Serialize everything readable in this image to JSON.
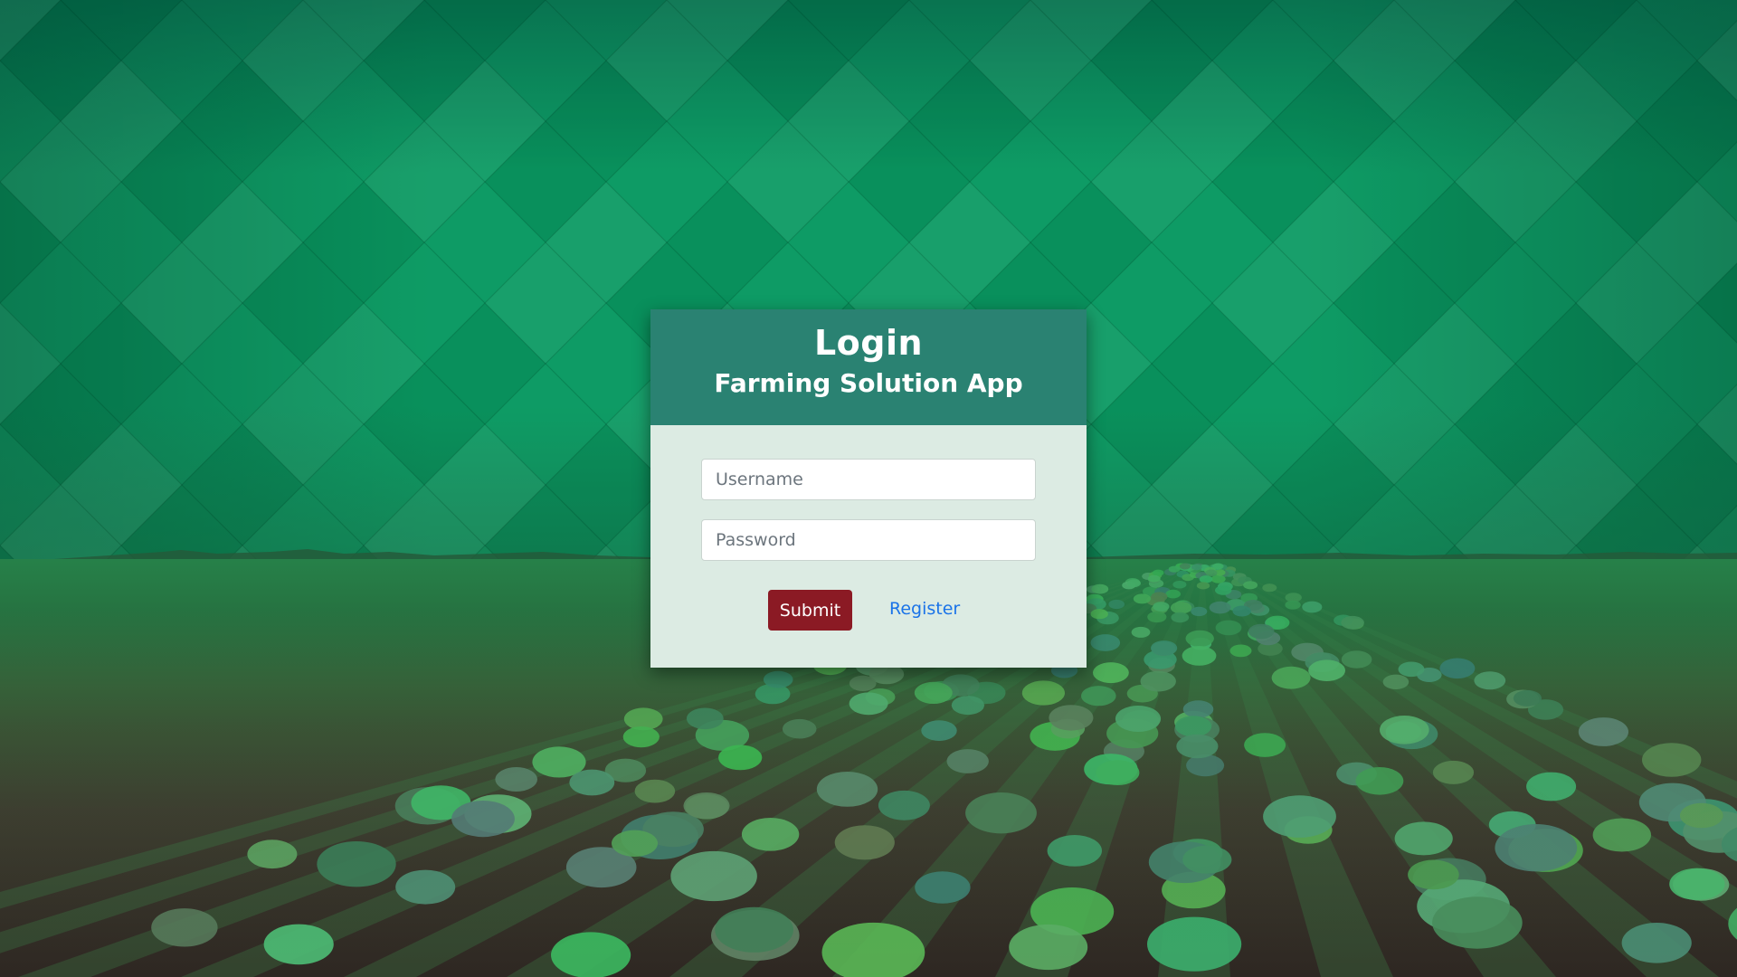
{
  "login": {
    "title": "Login",
    "subtitle": "Farming Solution App",
    "username_placeholder": "Username",
    "password_placeholder": "Password",
    "username_value": "",
    "password_value": "",
    "submit_label": "Submit",
    "register_label": "Register"
  },
  "colors": {
    "header_bg": "#2a8272",
    "body_bg": "#dcebe3",
    "submit_bg": "#8b1a24",
    "link": "#1a73e8",
    "background_green": "#0a9a62"
  },
  "background": {
    "pattern": "green-diamond-pattern",
    "scene": "crop-field-rows"
  }
}
